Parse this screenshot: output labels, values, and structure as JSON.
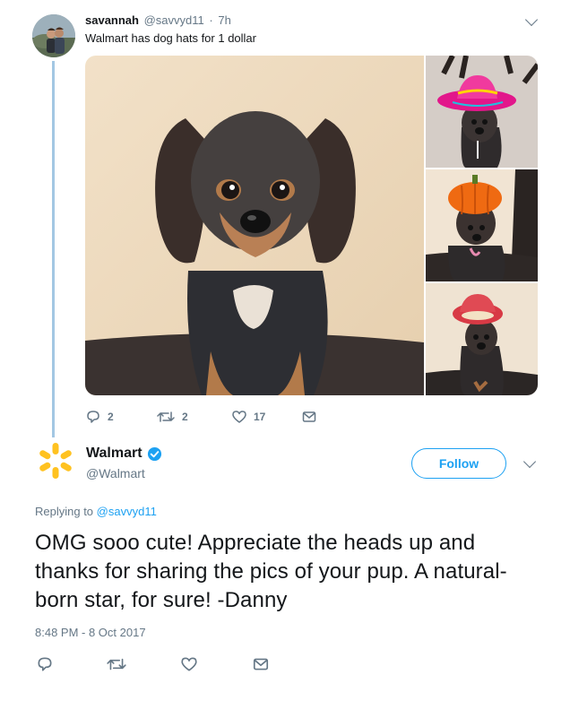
{
  "tweet": {
    "author_name": "savannah",
    "author_handle": "@savvyd11",
    "separator": "·",
    "time": "7h",
    "text": "Walmart has dog hats for 1 dollar",
    "stats": {
      "replies": "2",
      "retweets": "2",
      "likes": "17"
    },
    "icons": [
      "reply-icon",
      "retweet-icon",
      "like-icon",
      "message-icon",
      "chevron-down-icon"
    ]
  },
  "reply": {
    "author_name": "Walmart",
    "author_handle": "@Walmart",
    "follow_label": "Follow",
    "replying_prefix": "Replying to",
    "replying_to": "@savvyd11",
    "text": "OMG sooo cute! Appreciate the heads up and thanks for sharing the pics of your pup. A natural-born star, for sure! -Danny",
    "timestamp": "8:48 PM - 8 Oct 2017"
  },
  "colors": {
    "accent": "#1da1f2",
    "secondary_text": "#657786",
    "thread_line": "#a3c7e3",
    "walmart_spark": "#ffc220"
  }
}
